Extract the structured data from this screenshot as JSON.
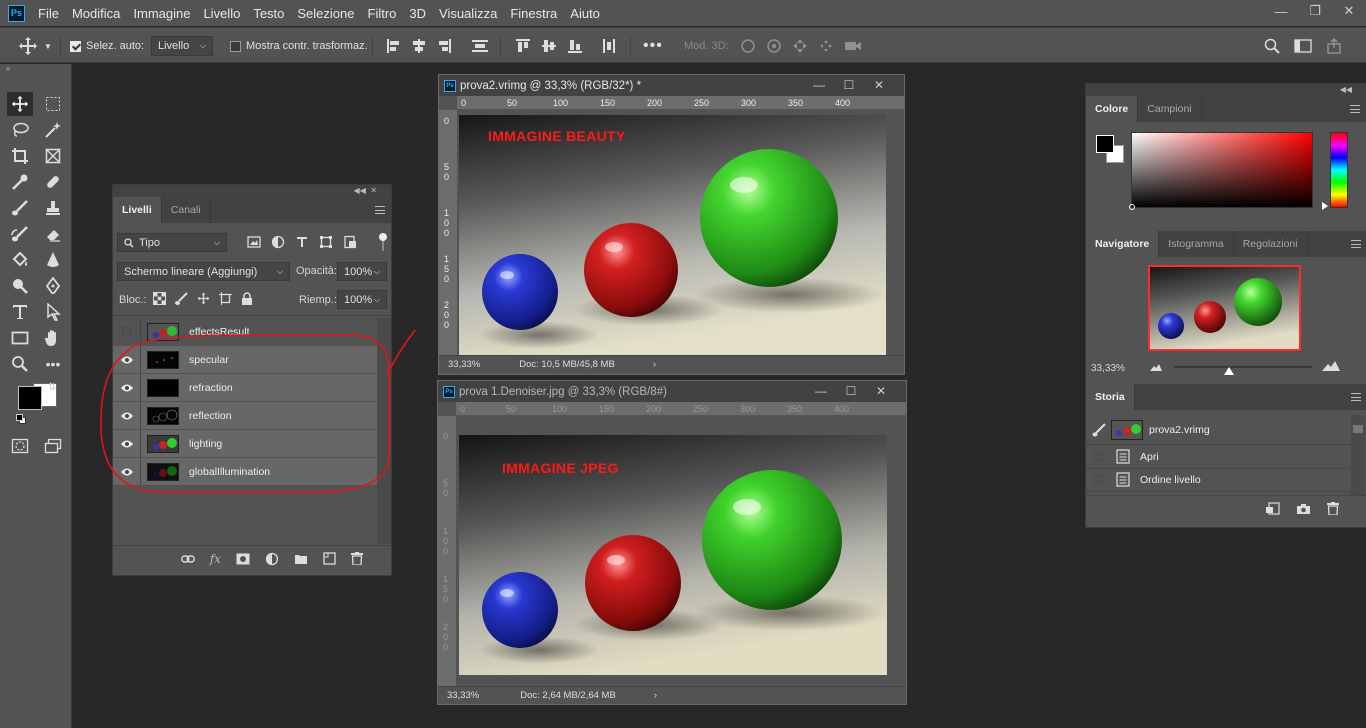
{
  "app": {
    "logo": "Ps"
  },
  "menu": [
    "File",
    "Modifica",
    "Immagine",
    "Livello",
    "Testo",
    "Selezione",
    "Filtro",
    "3D",
    "Visualizza",
    "Finestra",
    "Aiuto"
  ],
  "options": {
    "auto_select_label": "Selez. auto:",
    "auto_select_value": "Livello",
    "transform_label": "Mostra contr. trasformaz.",
    "mode3d_label": "Mod. 3D:"
  },
  "layers_panel": {
    "tabs": [
      "Livelli",
      "Canali"
    ],
    "filter": "Tipo",
    "blend_mode": "Schermo lineare (Aggiungi)",
    "opacity_label": "Opacità:",
    "opacity_value": "100%",
    "lock_label": "Bloc.:",
    "fill_label": "Riemp.:",
    "fill_value": "100%",
    "layers": [
      {
        "name": "effectsResult",
        "visible": false
      },
      {
        "name": "specular",
        "visible": true
      },
      {
        "name": "refraction",
        "visible": true
      },
      {
        "name": "reflection",
        "visible": true
      },
      {
        "name": "lighting",
        "visible": true
      },
      {
        "name": "globalIllumination",
        "visible": true
      }
    ]
  },
  "doc1": {
    "title": "prova2.vrimg @ 33,3% (RGB/32*) *",
    "label": "IMMAGINE BEAUTY",
    "zoom": "33,33%",
    "doc_info": "Doc: 10,5 MB/45,8 MB",
    "ruler_h": [
      "0",
      "50",
      "100",
      "150",
      "200",
      "250",
      "300",
      "350",
      "400"
    ],
    "ruler_v": [
      [
        "0"
      ],
      [
        "5",
        "0"
      ],
      [
        "1",
        "0",
        "0"
      ],
      [
        "1",
        "5",
        "0"
      ],
      [
        "2",
        "0",
        "0"
      ]
    ]
  },
  "doc2": {
    "title": "prova 1.Denoiser.jpg @ 33,3% (RGB/8#)",
    "label": "IMMAGINE JPEG",
    "zoom": "33,33%",
    "doc_info": "Doc: 2,64 MB/2,64 MB",
    "ruler_h": [
      "0",
      "50",
      "100",
      "150",
      "200",
      "250",
      "300",
      "350",
      "400"
    ],
    "ruler_v": [
      [
        "0"
      ],
      [
        "5",
        "0"
      ],
      [
        "1",
        "0",
        "0"
      ],
      [
        "1",
        "5",
        "0"
      ],
      [
        "2",
        "0",
        "0"
      ]
    ]
  },
  "color_panel": {
    "tabs": [
      "Colore",
      "Campioni"
    ]
  },
  "navigator_panel": {
    "tabs": [
      "Navigatore",
      "Istogramma",
      "Regolazioni"
    ],
    "zoom": "33,33%"
  },
  "history_panel": {
    "tabs": [
      "Storia"
    ],
    "snapshot": "prova2.vrimg",
    "items": [
      "Apri",
      "Ordine livello"
    ]
  },
  "colors": {
    "accent_red": "#ff1a1a",
    "ps_blue": "#31a8ff"
  }
}
